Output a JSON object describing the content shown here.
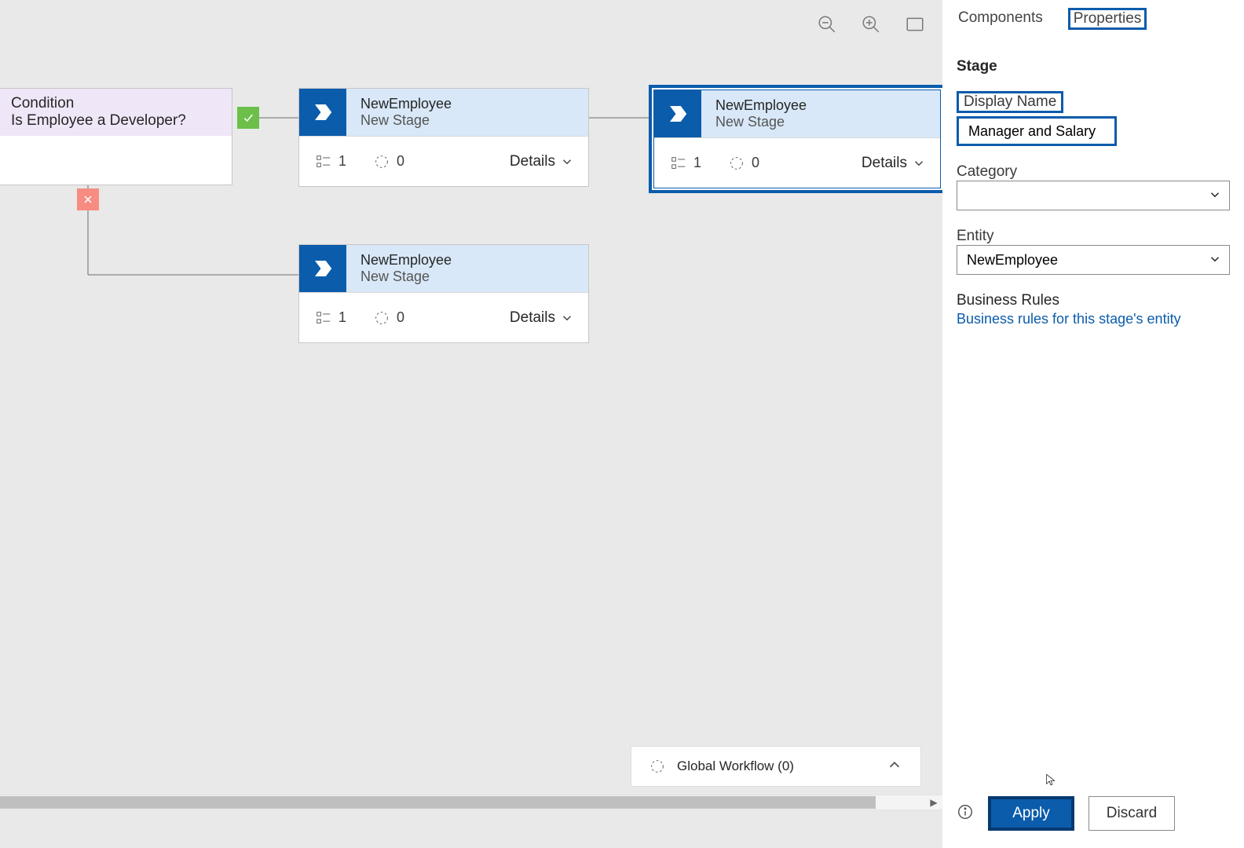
{
  "toolbar": {
    "zoom_out": "zoom-out",
    "zoom_in": "zoom-in",
    "fit": "fit-screen"
  },
  "condition": {
    "type_label": "Condition",
    "question": "Is Employee a Developer?"
  },
  "stages": {
    "a": {
      "entity": "NewEmployee",
      "name": "New Stage",
      "steps": "1",
      "secondary": "0",
      "details": "Details"
    },
    "b": {
      "entity": "NewEmployee",
      "name": "New Stage",
      "steps": "1",
      "secondary": "0",
      "details": "Details"
    },
    "c": {
      "entity": "NewEmployee",
      "name": "New Stage",
      "steps": "1",
      "secondary": "0",
      "details": "Details"
    }
  },
  "global_workflow_label": "Global Workflow (0)",
  "panel": {
    "tabs": {
      "components": "Components",
      "properties": "Properties"
    },
    "section": "Stage",
    "display_name_label": "Display Name",
    "display_name_value": "Manager and Salary",
    "category_label": "Category",
    "category_value": "",
    "entity_label": "Entity",
    "entity_value": "NewEmployee",
    "business_rules_label": "Business Rules",
    "business_rules_link": "Business rules for this stage's entity",
    "apply": "Apply",
    "discard": "Discard"
  }
}
